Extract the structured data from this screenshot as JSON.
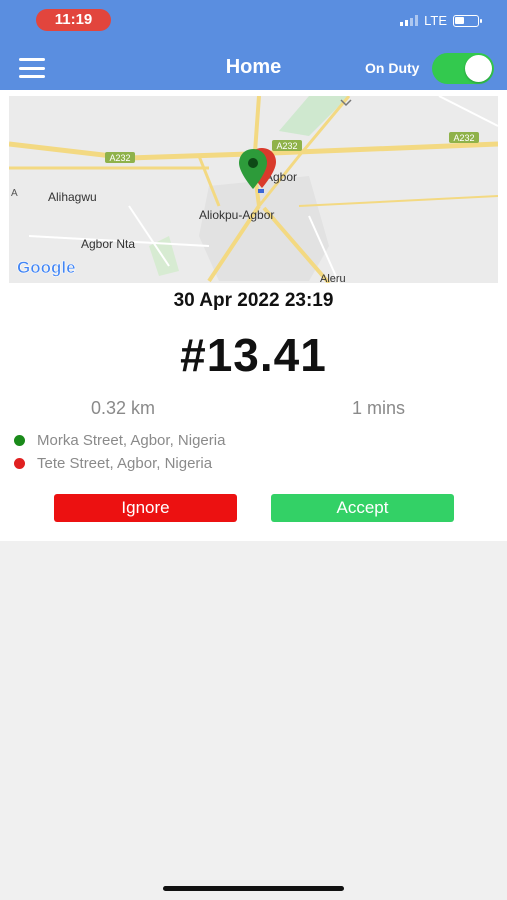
{
  "status_bar": {
    "time": "11:19",
    "network": "LTE"
  },
  "header": {
    "title": "Home",
    "duty_label": "On Duty",
    "duty_on": true
  },
  "map": {
    "labels": {
      "road_1": "A232",
      "road_2": "A232",
      "road_3": "A232",
      "town_alihagwu": "Alihagwu",
      "town_agbor": "Agbor",
      "town_aliokpu": "Aliokpu-Agbor",
      "town_agbor_nta": "Agbor Nta",
      "town_aleru": "Aleru",
      "edge_label": "A"
    },
    "attribution": "Google"
  },
  "trip": {
    "datetime": "30 Apr 2022 23:19",
    "fare": "#13.41",
    "distance": "0.32 km",
    "duration": "1 mins",
    "pickup": "Morka Street, Agbor, Nigeria",
    "dropoff": "Tete Street, Agbor, Nigeria"
  },
  "actions": {
    "ignore_label": "Ignore",
    "accept_label": "Accept"
  },
  "colors": {
    "header": "#5a8ee0",
    "toggle_on": "#33c94e",
    "ignore": "#ec1111",
    "accept": "#33d166",
    "pickup_dot": "#1a8a1a",
    "dropoff_dot": "#e02020"
  }
}
